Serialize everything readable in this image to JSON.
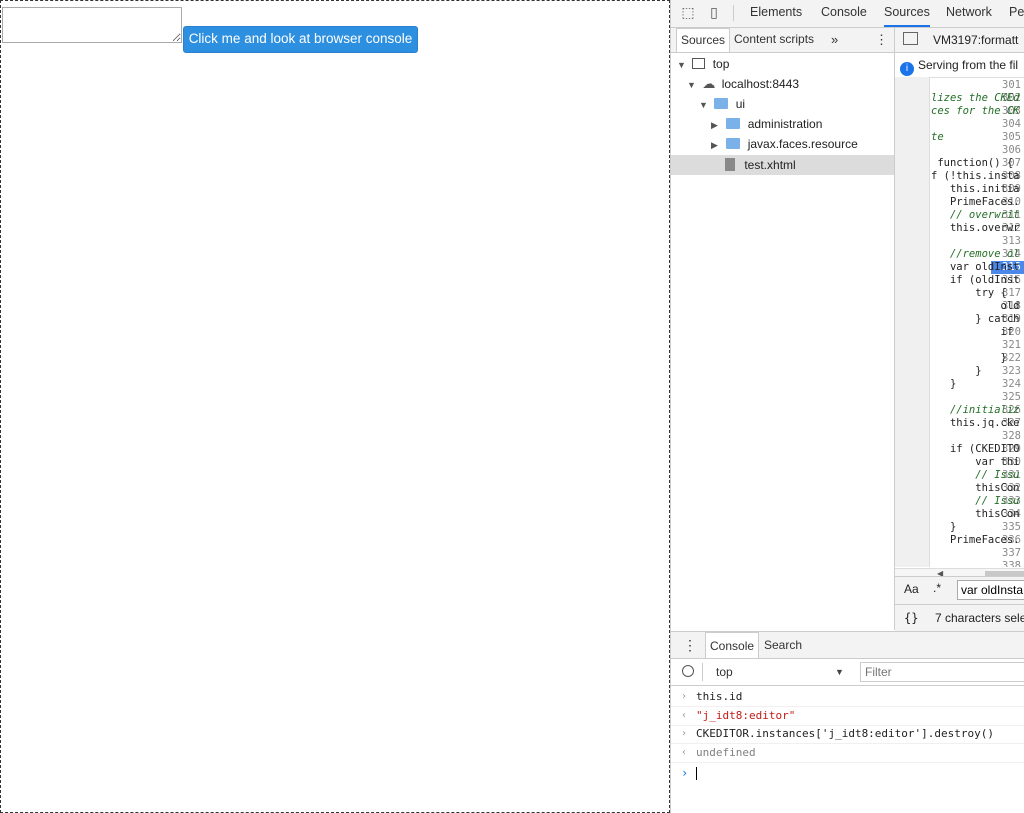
{
  "page": {
    "button_label": "Click me and look at browser console"
  },
  "devtools": {
    "main_tabs": [
      "Elements",
      "Console",
      "Sources",
      "Network",
      "Pe"
    ],
    "active_main_tab": "Sources",
    "navigator": {
      "tabs": [
        "Sources",
        "Content scripts"
      ],
      "more": "»",
      "tree": [
        {
          "label": "top",
          "depth": 0,
          "kind": "frame"
        },
        {
          "label": "localhost:8443",
          "depth": 1,
          "kind": "cloud"
        },
        {
          "label": "ui",
          "depth": 2,
          "kind": "folder"
        },
        {
          "label": "administration",
          "depth": 3,
          "kind": "folder"
        },
        {
          "label": "javax.faces.resource",
          "depth": 3,
          "kind": "folder"
        },
        {
          "label": "test.xhtml",
          "depth": 3,
          "kind": "file"
        }
      ]
    },
    "editor": {
      "tab_label": "VM3197:formatt",
      "banner": "Serving from the fil",
      "breakpoint_line": 315,
      "lines": [
        {
          "n": "301",
          "t": ""
        },
        {
          "n": "302",
          "t": "lizes the CKEd",
          "c": "cm"
        },
        {
          "n": "303",
          "t": "ces for the CK",
          "c": "cm"
        },
        {
          "n": "304",
          "t": ""
        },
        {
          "n": "305",
          "t": "te",
          "c": "cm"
        },
        {
          "n": "306",
          "t": ""
        },
        {
          "n": "307",
          "t": " function() {"
        },
        {
          "n": "308",
          "t": "f (!this.insta"
        },
        {
          "n": "309",
          "t": "   this.initia"
        },
        {
          "n": "310",
          "t": "   PrimeFaces."
        },
        {
          "n": "311",
          "t": "   // overwrit",
          "c": "cm"
        },
        {
          "n": "312",
          "t": "   this.overwr"
        },
        {
          "n": "313",
          "t": ""
        },
        {
          "n": "314",
          "t": "   //remove ol",
          "c": "cm"
        },
        {
          "n": "315",
          "t": "   var oldInst"
        },
        {
          "n": "316",
          "t": "   if (oldInst"
        },
        {
          "n": "317",
          "t": "       try {"
        },
        {
          "n": "318",
          "t": "           old"
        },
        {
          "n": "319",
          "t": "       } catch"
        },
        {
          "n": "320",
          "t": "           if"
        },
        {
          "n": "321",
          "t": ""
        },
        {
          "n": "322",
          "t": "           }"
        },
        {
          "n": "323",
          "t": "       }"
        },
        {
          "n": "324",
          "t": "   }"
        },
        {
          "n": "325",
          "t": ""
        },
        {
          "n": "326",
          "t": "   //initializ",
          "c": "cm"
        },
        {
          "n": "327",
          "t": "   this.jq.cke"
        },
        {
          "n": "328",
          "t": ""
        },
        {
          "n": "329",
          "t": "   if (CKEDITO"
        },
        {
          "n": "330",
          "t": "       var thi"
        },
        {
          "n": "331",
          "t": "       // Issu",
          "c": "cm"
        },
        {
          "n": "332",
          "t": "       thisCon"
        },
        {
          "n": "333",
          "t": "       // Issu",
          "c": "cm"
        },
        {
          "n": "334",
          "t": "       thisCon"
        },
        {
          "n": "335",
          "t": "   }"
        },
        {
          "n": "336",
          "t": "   PrimeFaces."
        },
        {
          "n": "337",
          "t": ""
        },
        {
          "n": "338",
          "t": ""
        }
      ],
      "search_aa": "Aa",
      "search_regex": ".*",
      "search_value": "var oldInsta",
      "status_icon": "{}",
      "status_text": "7 characters sele"
    },
    "drawer": {
      "tabs": [
        "Console",
        "Search"
      ],
      "context": "top",
      "filter_placeholder": "Filter",
      "messages": [
        {
          "dir": "›",
          "text": "this.id",
          "kind": "input"
        },
        {
          "dir": "‹",
          "text": "\"j_idt8:editor\"",
          "kind": "result-string"
        },
        {
          "dir": "›",
          "text": "CKEDITOR.instances['j_idt8:editor'].destroy()",
          "kind": "input"
        },
        {
          "dir": "‹",
          "text": "undefined",
          "kind": "result-undefined"
        }
      ],
      "prompt": "›"
    }
  }
}
